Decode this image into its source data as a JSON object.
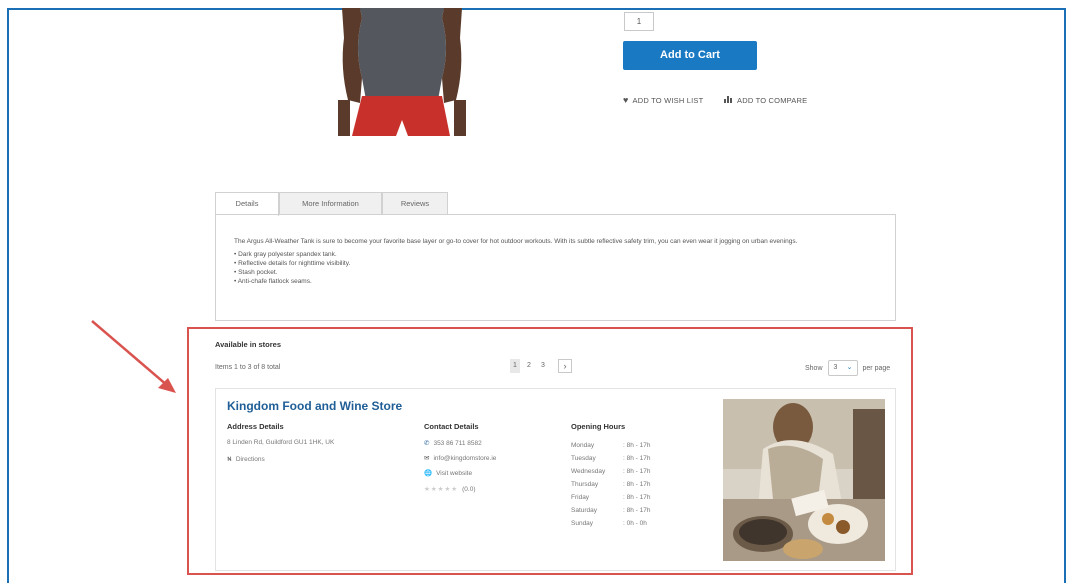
{
  "product": {
    "qty": "1",
    "add_to_cart": "Add to Cart",
    "wish_list": "ADD TO WISH LIST",
    "compare": "ADD TO COMPARE"
  },
  "tabs": [
    "Details",
    "More Information",
    "Reviews"
  ],
  "details": {
    "description": "The Argus All-Weather Tank is sure to become your favorite base layer or go-to cover for hot outdoor workouts. With its subtle reflective safety trim, you can even wear it jogging on urban evenings.",
    "bullets": [
      "• Dark gray polyester spandex tank.",
      "• Reflective details for nighttime visibility.",
      "• Stash pocket.",
      "• Anti-chafe flatlock seams."
    ]
  },
  "stores": {
    "title": "Available in stores",
    "items_total": "Items 1 to 3 of 8 total",
    "pages": [
      "1",
      "2",
      "3"
    ],
    "next": "›",
    "show_label": "Show",
    "limit": "3",
    "per_page": "per page"
  },
  "store": {
    "name": "Kingdom Food and Wine Store",
    "address_title": "Address Details",
    "address": "8 Linden Rd, Guildford GU1 1HK, UK",
    "directions": "Directions",
    "contact_title": "Contact Details",
    "phone": "353 86 711 8582",
    "email": "info@kingdomstore.ie",
    "website": "Visit website",
    "rating": "(0.0)",
    "hours_title": "Opening Hours",
    "hours": [
      {
        "day": "Monday",
        "time": ": 8h - 17h"
      },
      {
        "day": "Tuesday",
        "time": ": 8h - 17h"
      },
      {
        "day": "Wednesday",
        "time": ": 8h - 17h"
      },
      {
        "day": "Thursday",
        "time": ": 8h - 17h"
      },
      {
        "day": "Friday",
        "time": ": 8h - 17h"
      },
      {
        "day": "Saturday",
        "time": ": 8h - 17h"
      },
      {
        "day": "Sunday",
        "time": ": 0h - 0h"
      }
    ]
  },
  "colors": {
    "accent": "#1979c3",
    "store_name": "#1f5e96",
    "highlight": "#d9534f",
    "frame": "#1a6fb5"
  }
}
